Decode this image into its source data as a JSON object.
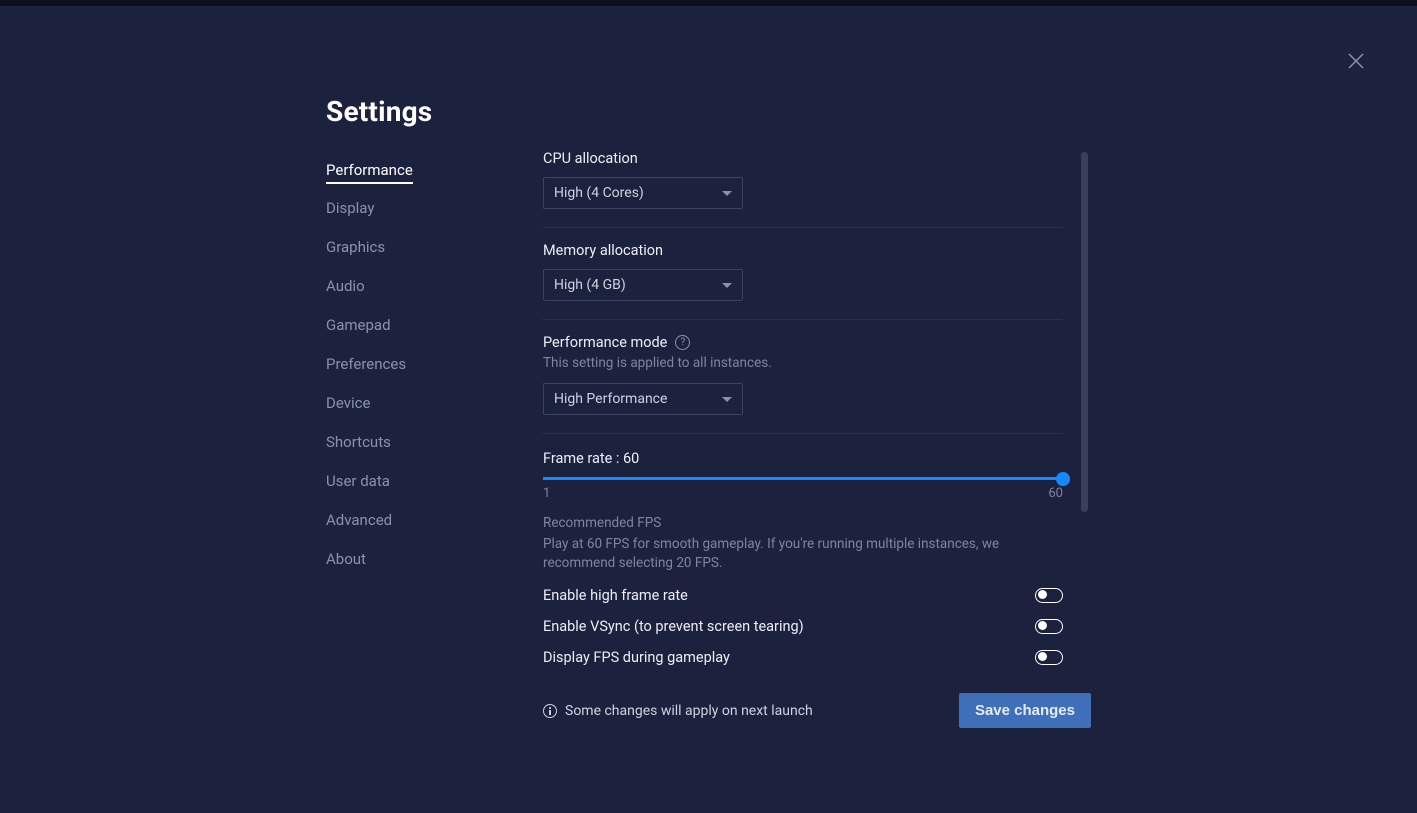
{
  "title": "Settings",
  "sidebar": {
    "items": [
      {
        "label": "Performance",
        "active": true
      },
      {
        "label": "Display"
      },
      {
        "label": "Graphics"
      },
      {
        "label": "Audio"
      },
      {
        "label": "Gamepad"
      },
      {
        "label": "Preferences"
      },
      {
        "label": "Device"
      },
      {
        "label": "Shortcuts"
      },
      {
        "label": "User data"
      },
      {
        "label": "Advanced"
      },
      {
        "label": "About"
      }
    ]
  },
  "settings": {
    "cpu": {
      "label": "CPU allocation",
      "value": "High (4 Cores)"
    },
    "memory": {
      "label": "Memory allocation",
      "value": "High (4 GB)"
    },
    "perfmode": {
      "label": "Performance mode",
      "note": "This setting is applied to all instances.",
      "value": "High Performance"
    },
    "framerate": {
      "label": "Frame rate : 60",
      "min": "1",
      "max": "60",
      "value": 60,
      "reco_title": "Recommended FPS",
      "reco_text": "Play at 60 FPS for smooth gameplay. If you're running multiple instances, we recommend selecting 20 FPS."
    },
    "toggles": {
      "highfr": {
        "label": "Enable high frame rate",
        "on": false
      },
      "vsync": {
        "label": "Enable VSync (to prevent screen tearing)",
        "on": false
      },
      "showfps": {
        "label": "Display FPS during gameplay",
        "on": false
      }
    }
  },
  "footer": {
    "note": "Some changes will apply on next launch",
    "save": "Save changes"
  }
}
